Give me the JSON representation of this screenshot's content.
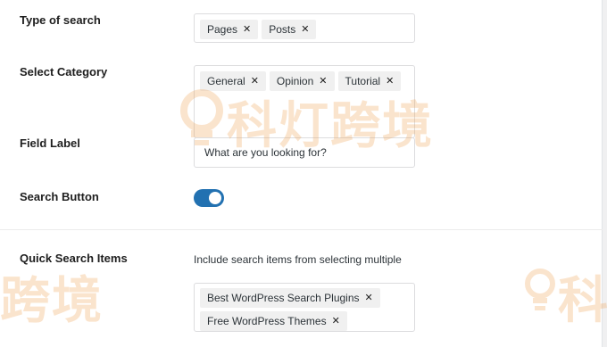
{
  "type_of_search": {
    "label": "Type of search",
    "tags": [
      "Pages",
      "Posts"
    ]
  },
  "select_category": {
    "label": "Select Category",
    "tags": [
      "General",
      "Opinion",
      "Tutorial"
    ]
  },
  "field_label": {
    "label": "Field Label",
    "value": "What are you looking for?"
  },
  "search_button": {
    "label": "Search Button",
    "enabled": true
  },
  "quick_search": {
    "label": "Quick Search Items",
    "help": "Include search items from selecting multiple",
    "tags": [
      "Best WordPress Search Plugins",
      "Free WordPress Themes"
    ]
  },
  "remove_glyph": "✕",
  "watermark": {
    "text": "科灯跨境",
    "text_partial": "跨境",
    "text_partial_right": "科"
  },
  "colors": {
    "toggle_on": "#2271b1",
    "watermark": "#f0a050"
  }
}
